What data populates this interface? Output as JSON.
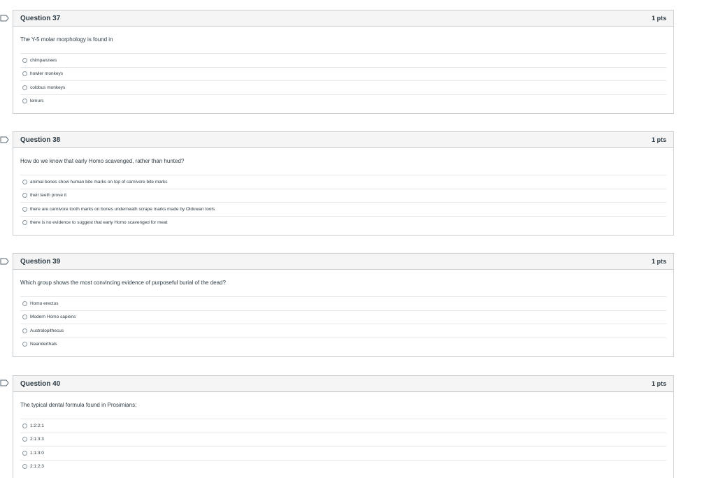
{
  "questions": [
    {
      "title": "Question 37",
      "points": "1 pts",
      "text": "The Y-5 molar morphology is found in",
      "answers": [
        "chimpanzees",
        "howler monkeys",
        "colobus monkeys",
        "lemurs"
      ]
    },
    {
      "title": "Question 38",
      "points": "1 pts",
      "text": "How do we know that early Homo scavenged, rather than hunted?",
      "answers": [
        "animal bones show human bite marks on top of carnivore bite marks",
        "their teeth prove it",
        "there are carnivore tooth marks on bones underneath scrape marks made by Olduwan tools",
        "there is no evidence to suggest that early Homo scavenged for meat"
      ]
    },
    {
      "title": "Question 39",
      "points": "1 pts",
      "text": "Which group shows the most convincing evidence of purposeful burial of the dead?",
      "answers": [
        "Homo erectus",
        "Modern Homo sapiens",
        "Australopithecus",
        "Neanderthals"
      ]
    },
    {
      "title": "Question 40",
      "points": "1 pts",
      "text": "The typical dental formula found in Prosimians:",
      "answers": [
        "1:2:2:1",
        "2:1:3:3",
        "1:1:3:0",
        "2:1:2:3"
      ]
    }
  ],
  "icons": {
    "flag": "flag-question-icon"
  },
  "colors": {
    "header_bg": "#f5f5f5",
    "border": "#c7cdd1",
    "text": "#2d3b45",
    "flag": "#556572"
  }
}
